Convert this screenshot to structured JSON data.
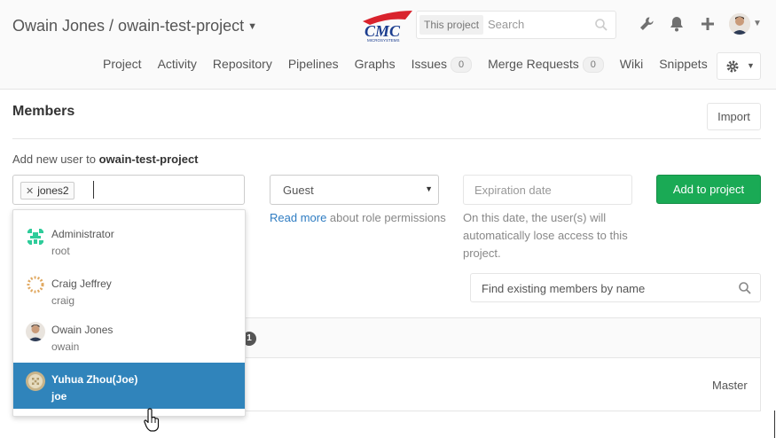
{
  "header": {
    "project_path": "Owain Jones / owain-test-project",
    "logo_text": "CMC",
    "logo_subtext": "MICROSYSTEMS",
    "search_scope": "This project",
    "search_placeholder": "Search"
  },
  "nav": {
    "items": [
      "Project",
      "Activity",
      "Repository",
      "Pipelines",
      "Graphs",
      "Issues",
      "Merge Requests",
      "Wiki",
      "Snippets"
    ],
    "issues_count": "0",
    "mr_count": "0"
  },
  "members": {
    "heading": "Members",
    "import_label": "Import",
    "add_prefix": "Add new user to ",
    "project_name": "owain-test-project",
    "token_value": "jones2",
    "role_value": "Guest",
    "role_help_link": "Read more",
    "role_help_text": " about role permissions",
    "expiration_placeholder": "Expiration date",
    "expiration_help": "On this date, the user(s) will automatically lose access to this project.",
    "add_button": "Add to project",
    "find_placeholder": "Find existing members by name",
    "count": "1",
    "access_level": "Master"
  },
  "dropdown": {
    "users": [
      {
        "name": "Administrator",
        "username": "root"
      },
      {
        "name": "Craig Jeffrey",
        "username": "craig"
      },
      {
        "name": "Owain Jones",
        "username": "owain"
      },
      {
        "name": "Yuhua Zhou(Joe)",
        "username": "joe"
      }
    ]
  },
  "colors": {
    "accent_green": "#1aaa55",
    "selected_blue": "#3084bb",
    "link_blue": "#2e7cc2"
  }
}
